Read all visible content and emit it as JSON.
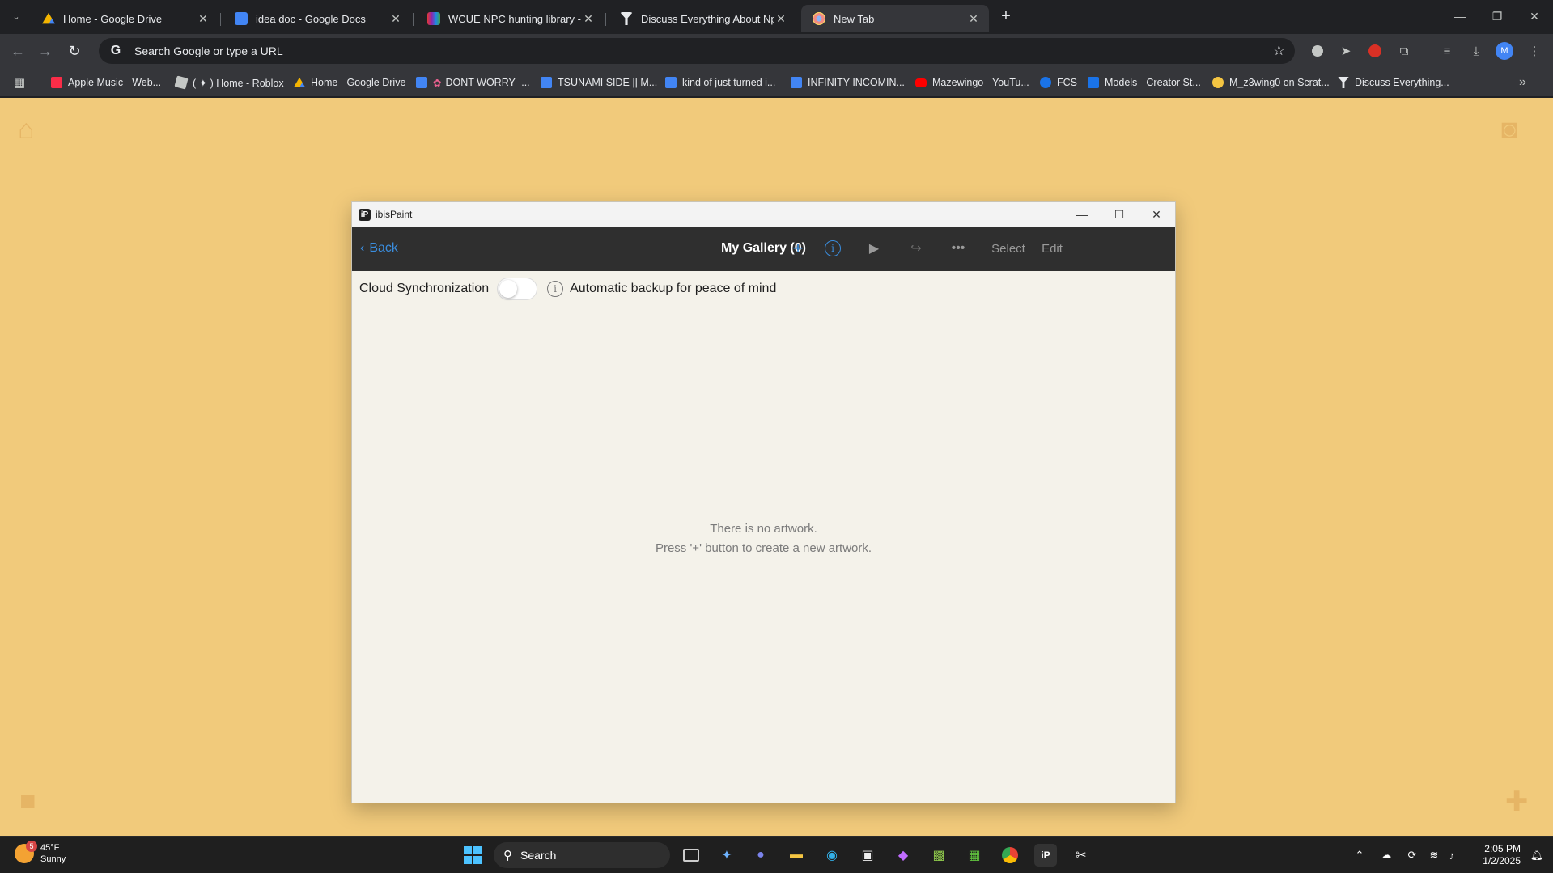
{
  "browser": {
    "tabs": [
      {
        "title": "Home - Google Drive",
        "icon": "google-drive-icon",
        "active": false
      },
      {
        "title": "idea doc - Google Docs",
        "icon": "google-docs-icon",
        "active": false
      },
      {
        "title": "WCUE NPC hunting library - Bo",
        "icon": "bookmark-favicon",
        "active": false
      },
      {
        "title": "Discuss Everything About Npc \\",
        "icon": "fandom-icon",
        "active": false
      },
      {
        "title": "New Tab",
        "icon": "chrome-newtab-icon",
        "active": true
      }
    ],
    "omnibox_placeholder": "Search Google or type a URL",
    "bookmarks": [
      {
        "label": "Apple Music - Web...",
        "color": "#fa2d48"
      },
      {
        "label": "( ✦ ) Home - Roblox",
        "color": "#e8eaed"
      },
      {
        "label": "Home - Google Drive",
        "color": "#4285f4"
      },
      {
        "label": "DONT WORRY -...",
        "color": "#4285f4"
      },
      {
        "label": "TSUNAMI SIDE || M...",
        "color": "#4285f4"
      },
      {
        "label": "kind of just turned i...",
        "color": "#4285f4"
      },
      {
        "label": "INFINITY INCOMIN...",
        "color": "#4285f4"
      },
      {
        "label": "Mazewingo - YouTu...",
        "color": "#ff0000"
      },
      {
        "label": "FCS",
        "color": "#1a73e8"
      },
      {
        "label": "Models - Creator St...",
        "color": "#1a73e8"
      },
      {
        "label": "M_z3wing0 on Scrat...",
        "color": "#f4c542"
      },
      {
        "label": "Discuss Everything...",
        "color": "#e8eaed"
      }
    ]
  },
  "ibis": {
    "window_title": "ibisPaint",
    "back_label": "Back",
    "gallery_title": "My Gallery (0)",
    "add_symbol": "+",
    "select_label": "Select",
    "edit_label": "Edit",
    "sync_label": "Cloud Synchronization",
    "sync_enabled": false,
    "backup_label": "Automatic backup for peace of mind",
    "empty_line1": "There is no artwork.",
    "empty_line2": "Press '+' button to create a new artwork.",
    "accent": "#3a8dde"
  },
  "taskbar": {
    "weather_temp": "45°F",
    "weather_desc": "Sunny",
    "weather_badge": "5",
    "search_label": "Search",
    "time": "2:05 PM",
    "date": "1/2/2025"
  },
  "colors": {
    "page_bg": "#f1ca7b",
    "chrome_dark": "#202124",
    "chrome_toolbar": "#35363a"
  }
}
